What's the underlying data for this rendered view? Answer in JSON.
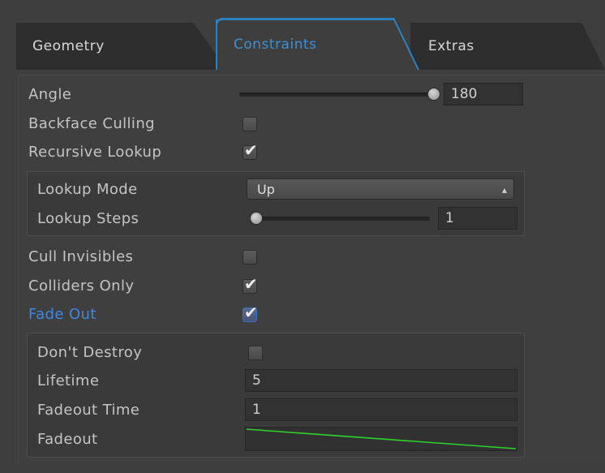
{
  "tabs": [
    {
      "label": "Geometry",
      "active": false
    },
    {
      "label": "Constraints",
      "active": true
    },
    {
      "label": "Extras",
      "active": false
    }
  ],
  "colors": {
    "active_tab": "#3d8fd1",
    "highlight_label": "#3f87e0",
    "curve": "#2bd42b"
  },
  "angle": {
    "label": "Angle",
    "value": "180",
    "slider_fraction": 1.0
  },
  "backface_culling": {
    "label": "Backface Culling",
    "checked": false
  },
  "recursive_lookup": {
    "label": "Recursive Lookup",
    "checked": true
  },
  "lookup": {
    "mode_label": "Lookup Mode",
    "mode_value": "Up",
    "steps_label": "Lookup Steps",
    "steps_value": "1",
    "steps_slider_fraction": 0.0
  },
  "cull_invisibles": {
    "label": "Cull Invisibles",
    "checked": false
  },
  "colliders_only": {
    "label": "Colliders Only",
    "checked": true
  },
  "fade_out": {
    "label": "Fade Out",
    "checked": true
  },
  "fade": {
    "dont_destroy_label": "Don't Destroy",
    "dont_destroy_checked": false,
    "lifetime_label": "Lifetime",
    "lifetime_value": "5",
    "fadeout_time_label": "Fadeout Time",
    "fadeout_time_value": "1",
    "fadeout_curve_label": "Fadeout"
  },
  "icons": {
    "check": "checkmark-icon",
    "dropdown": "updown-arrow-icon"
  }
}
